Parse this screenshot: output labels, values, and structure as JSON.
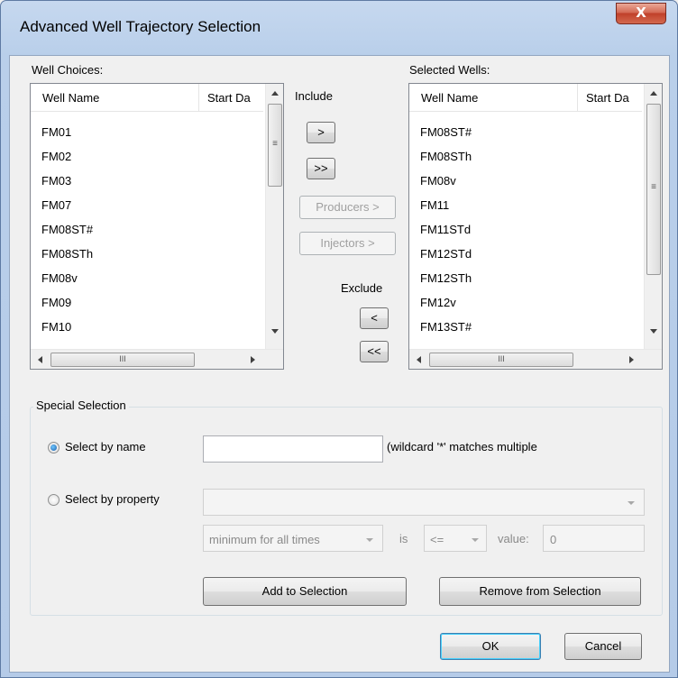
{
  "window": {
    "title": "Advanced Well Trajectory Selection",
    "close_glyph": "X"
  },
  "well_choices": {
    "label": "Well Choices:",
    "columns": [
      "Well Name",
      "Start Da"
    ],
    "rows": [
      "FM01",
      "FM02",
      "FM03",
      "FM07",
      "FM08ST#",
      "FM08STh",
      "FM08v",
      "FM09",
      "FM10"
    ]
  },
  "selected_wells": {
    "label": "Selected Wells:",
    "columns": [
      "Well Name",
      "Start Da"
    ],
    "rows": [
      "FM08ST#",
      "FM08STh",
      "FM08v",
      "FM11",
      "FM11STd",
      "FM12STd",
      "FM12STh",
      "FM12v",
      "FM13ST#"
    ]
  },
  "scroll": {
    "grip_v": "≡",
    "grip_h": "III"
  },
  "middle": {
    "include_label": "Include",
    "add_one": ">",
    "add_all": ">>",
    "producers": "Producers >",
    "injectors": "Injectors >",
    "exclude_label": "Exclude",
    "remove_one": "<",
    "remove_all": "<<"
  },
  "special": {
    "title": "Special Selection",
    "by_name_label": "Select by name",
    "by_name_value": "",
    "wildcard_note": "(wildcard '*' matches multiple",
    "by_property_label": "Select by property",
    "property_value": "",
    "aggregate_value": "minimum for all times",
    "is_label": "is",
    "operator_value": "<=",
    "value_label": "value:",
    "value_value": "0",
    "add_button": "Add to Selection",
    "remove_button": "Remove from Selection"
  },
  "footer": {
    "ok": "OK",
    "cancel": "Cancel"
  }
}
